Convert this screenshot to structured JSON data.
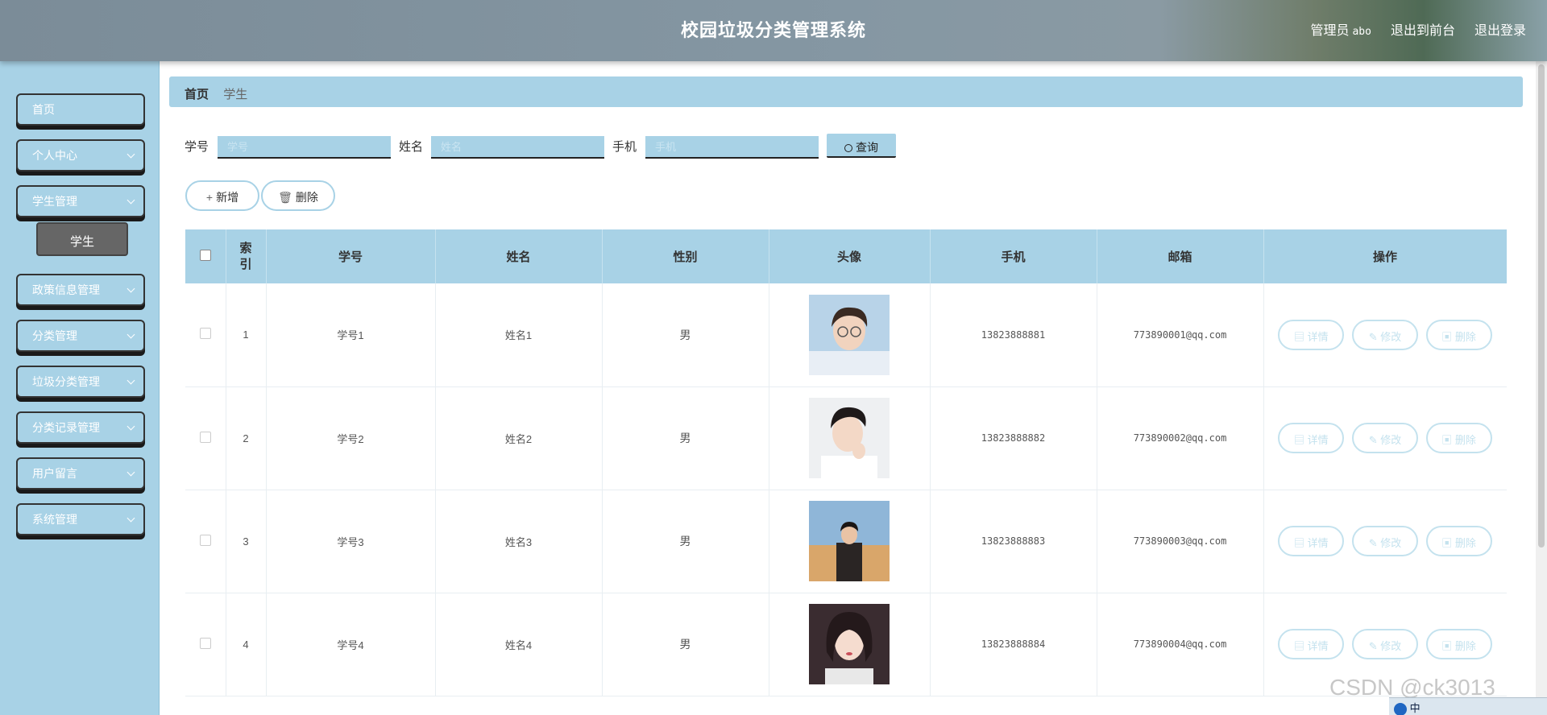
{
  "header": {
    "title": "校园垃圾分类管理系统",
    "admin_role": "管理员",
    "admin_name": "abo",
    "to_frontend": "退出到前台",
    "logout": "退出登录"
  },
  "sidebar": {
    "items": [
      {
        "label": "首页",
        "has_children": false
      },
      {
        "label": "个人中心",
        "has_children": true
      },
      {
        "label": "学生管理",
        "has_children": true
      },
      {
        "label": "政策信息管理",
        "has_children": true
      },
      {
        "label": "分类管理",
        "has_children": true
      },
      {
        "label": "垃圾分类管理",
        "has_children": true
      },
      {
        "label": "分类记录管理",
        "has_children": true
      },
      {
        "label": "用户留言",
        "has_children": true
      },
      {
        "label": "系统管理",
        "has_children": true
      }
    ],
    "active_sub": "学生"
  },
  "breadcrumb": {
    "home": "首页",
    "current": "学生"
  },
  "search": {
    "fields": [
      {
        "label": "学号",
        "placeholder": "学号"
      },
      {
        "label": "姓名",
        "placeholder": "姓名"
      },
      {
        "label": "手机",
        "placeholder": "手机"
      }
    ],
    "query_label": "查询"
  },
  "actions": {
    "add_label": "新增",
    "delete_label": "删除",
    "add_icon": "plus-icon",
    "delete_icon": "trash-icon"
  },
  "table": {
    "columns": [
      "索引",
      "学号",
      "姓名",
      "性别",
      "头像",
      "手机",
      "邮箱",
      "操作"
    ],
    "rows": [
      {
        "index": "1",
        "student_id": "学号1",
        "name": "姓名1",
        "gender": "男",
        "phone": "13823888881",
        "email": "773890001@qq.com"
      },
      {
        "index": "2",
        "student_id": "学号2",
        "name": "姓名2",
        "gender": "男",
        "phone": "13823888882",
        "email": "773890002@qq.com"
      },
      {
        "index": "3",
        "student_id": "学号3",
        "name": "姓名3",
        "gender": "男",
        "phone": "13823888883",
        "email": "773890003@qq.com"
      },
      {
        "index": "4",
        "student_id": "学号4",
        "name": "姓名4",
        "gender": "男",
        "phone": "13823888884",
        "email": "773890004@qq.com"
      }
    ],
    "row_actions": {
      "detail": "详情",
      "edit": "修改",
      "delete": "删除"
    }
  },
  "watermark": "CSDN @ck3013",
  "tray_text": "中",
  "colors": {
    "accent": "#a8d2e6",
    "header_bg": "#7f909b",
    "op_button_border": "#c4e2ee"
  }
}
